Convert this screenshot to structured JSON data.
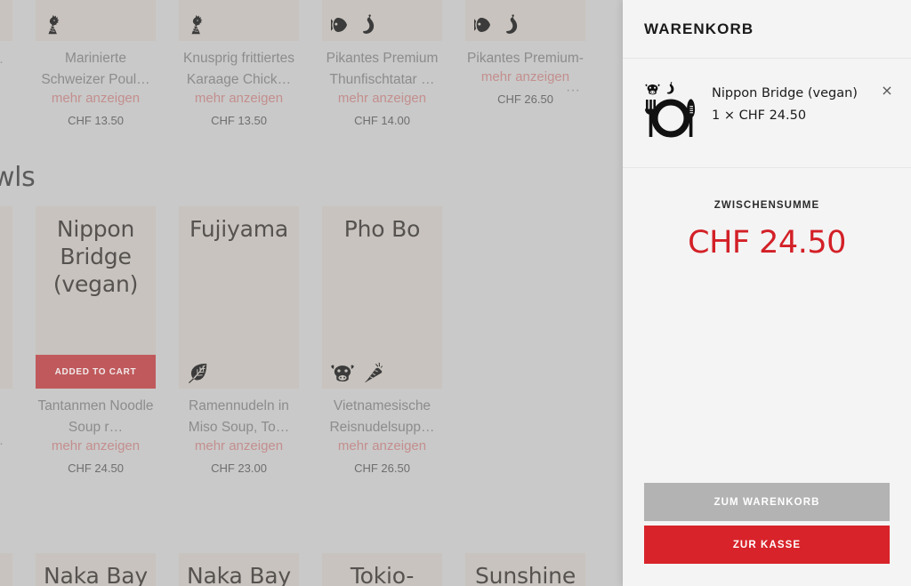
{
  "catalog": {
    "section_title": "wls",
    "edge_fragment_texts": [
      "··",
      "··",
      "··"
    ],
    "rows": [
      {
        "id": "row-skewers",
        "cards": [
          {
            "name": "Marinierte Schweizer Poul…",
            "more_label": "mehr anzeigen",
            "price": "CHF 13.50",
            "icons": [
              "chicken-icon"
            ],
            "dish_title": "",
            "added": false
          },
          {
            "name": "Knusprig frittiertes Karaage Chick…",
            "more_label": "mehr anzeigen",
            "price": "CHF 13.50",
            "icons": [
              "chicken-icon"
            ],
            "dish_title": "",
            "added": false
          },
          {
            "name": "Pikantes Premium Thunfischtatar …",
            "more_label": "mehr anzeigen",
            "price": "CHF 14.00",
            "icons": [
              "fish-icon",
              "chili-icon"
            ],
            "dish_title": "",
            "added": false
          },
          {
            "name": "Pikantes Premium-",
            "more_label": "mehr anzeigen",
            "price": "CHF 26.50",
            "icons": [
              "fish-icon",
              "chili-icon"
            ],
            "dish_title": "",
            "added": false
          }
        ]
      },
      {
        "id": "row-bowls",
        "cards": [
          {
            "name": "Tantanmen Noodle Soup r…",
            "more_label": "mehr anzeigen",
            "price": "CHF 24.50",
            "icons": [],
            "dish_title": "Nippon Bridge (vegan)",
            "added": true,
            "added_label": "ADDED TO CART"
          },
          {
            "name": "Ramennudeln in Miso Soup, To…",
            "more_label": "mehr anzeigen",
            "price": "CHF 23.00",
            "icons": [
              "leaf-icon"
            ],
            "dish_title": "Fujiyama",
            "added": false
          },
          {
            "name": "Vietnamesische Reisnudelsupp…",
            "more_label": "mehr anzeigen",
            "price": "CHF 26.50",
            "icons": [
              "cow-icon",
              "carrot-icon"
            ],
            "dish_title": "Pho Bo",
            "added": false
          }
        ]
      },
      {
        "id": "row-next",
        "cards": [
          {
            "dish_title": "Naka Bay",
            "name": "",
            "more_label": "",
            "price": "",
            "icons": [],
            "added": false
          },
          {
            "dish_title": "Naka Bay",
            "name": "",
            "more_label": "",
            "price": "",
            "icons": [],
            "added": false
          },
          {
            "dish_title": "Tokio-",
            "name": "",
            "more_label": "",
            "price": "",
            "icons": [],
            "added": false
          },
          {
            "dish_title": "Sunshine",
            "name": "",
            "more_label": "",
            "price": "",
            "icons": [],
            "added": false
          }
        ]
      }
    ]
  },
  "cart": {
    "title": "WARENKORB",
    "items": [
      {
        "name": "Nippon Bridge (vegan)",
        "qty_price": "1 × CHF 24.50",
        "remove_label": "×",
        "thumb_icons": [
          "cow-icon",
          "chili-icon"
        ],
        "thumb_main": "plate-cutlery-icon"
      }
    ],
    "subtotal_label": "ZWISCHENSUMME",
    "subtotal_amount": "CHF 24.50",
    "buttons": {
      "view_cart": "ZUM WARENKORB",
      "checkout": "ZUR KASSE"
    }
  },
  "colors": {
    "accent_red": "#d8232a",
    "subtotal_red": "#d32027",
    "added_btn": "#c0595c",
    "more_link": "#c48e8e",
    "card_bg": "#c8c3be",
    "page_bg": "#c9c9c9",
    "panel_bg": "#f4f4f4",
    "grey_btn": "#b3b3b3"
  }
}
